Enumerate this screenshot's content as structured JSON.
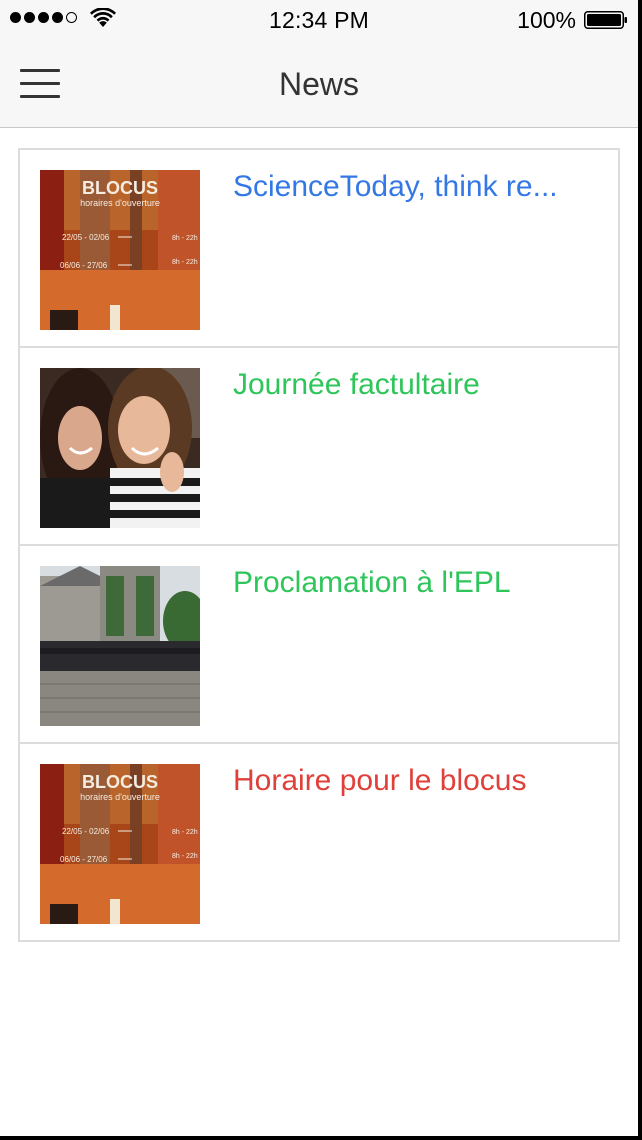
{
  "status_bar": {
    "time": "12:34 PM",
    "battery_percent": "100%",
    "signal_bars_filled": 4,
    "signal_bars_total": 5
  },
  "nav": {
    "title": "News",
    "menu_icon": "hamburger-menu-icon"
  },
  "news": [
    {
      "title": "ScienceToday, think re...",
      "color": "#3478e5",
      "thumbnail": "blocus-poster"
    },
    {
      "title": "Journée factultaire",
      "color": "#2ec55a",
      "thumbnail": "two-students-photo"
    },
    {
      "title": "Proclamation à l'EPL",
      "color": "#2ec55a",
      "thumbnail": "group-photo-building"
    },
    {
      "title": "Horaire pour le blocus",
      "color": "#e0403a",
      "thumbnail": "blocus-poster"
    }
  ],
  "poster": {
    "heading": "BLOCUS",
    "subheading": "horaires d'ouverture",
    "row1_dates": "22/05 - 02/06",
    "row1_hours": "8h - 22h",
    "row2_dates": "06/06 - 27/06",
    "row2_hours": "8h - 22h"
  }
}
